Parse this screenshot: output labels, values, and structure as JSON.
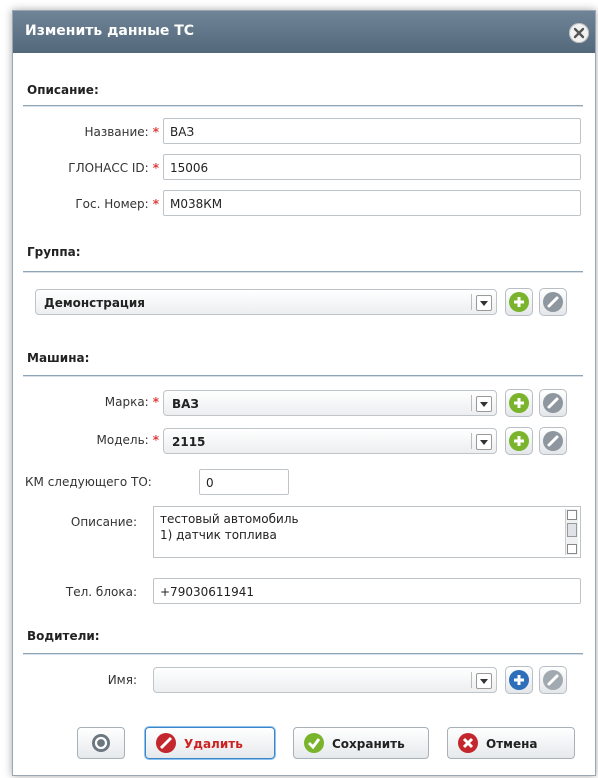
{
  "dialog": {
    "title": "Изменить данные ТС"
  },
  "sections": {
    "description": "Описание:",
    "group": "Группа:",
    "machine": "Машина:",
    "drivers": "Водители:"
  },
  "fields": {
    "name": {
      "label": "Название:",
      "value": "ВАЗ"
    },
    "glonass": {
      "label": "ГЛОНАСС ID:",
      "value": "15006"
    },
    "plate": {
      "label": "Гос. Номер:",
      "value": "М038КМ"
    },
    "required_mark": "*"
  },
  "group": {
    "selected": "Демонстрация"
  },
  "machine": {
    "brand": {
      "label": "Марка:",
      "selected": "ВАЗ"
    },
    "model": {
      "label": "Модель:",
      "selected": "2115"
    },
    "next_service": {
      "label": "КМ следующего ТО:",
      "value": "0"
    },
    "description": {
      "label": "Описание:",
      "line1": "тестовый автомобиль",
      "line2": "1) датчик топлива"
    },
    "phone": {
      "label": "Тел. блока:",
      "value": "+79030611941"
    }
  },
  "drivers": {
    "name": {
      "label": "Имя:",
      "selected": ""
    }
  },
  "buttons": {
    "delete": "Удалить",
    "save": "Сохранить",
    "cancel": "Отмена"
  },
  "colors": {
    "add_green": "#7ab42c",
    "edit_gray": "#8e979f",
    "add_blue": "#2f6eb8",
    "delete_red": "#c4262e",
    "save_green": "#7ab42c",
    "cancel_red": "#c4262e"
  }
}
